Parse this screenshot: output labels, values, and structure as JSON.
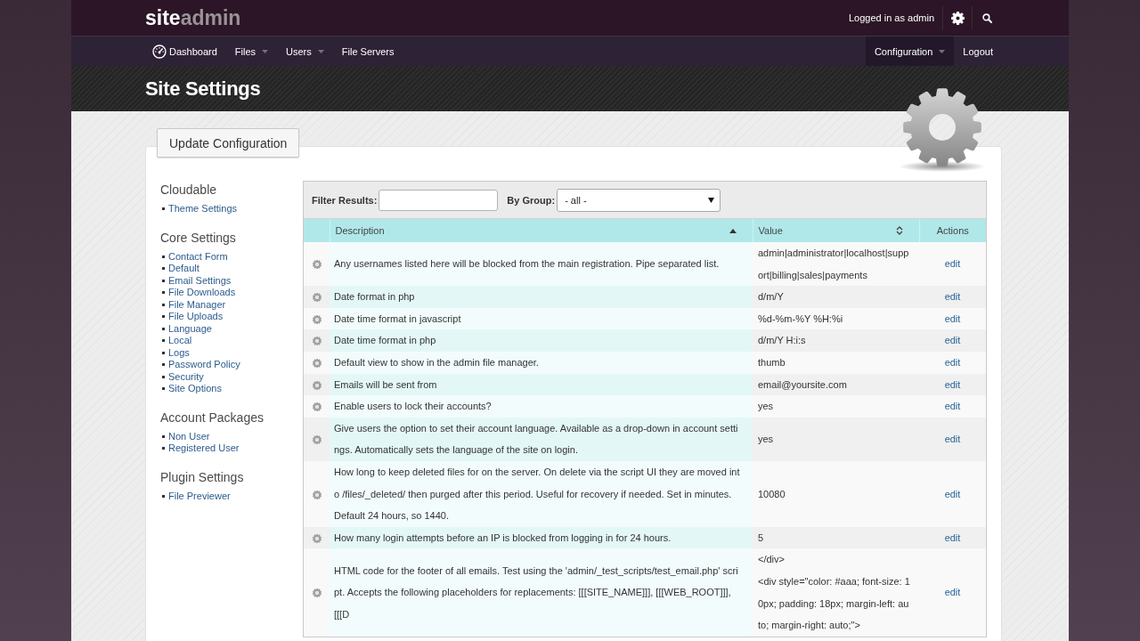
{
  "header": {
    "logo": [
      "site",
      "admin"
    ],
    "user_label": "Logged in as admin"
  },
  "nav": {
    "left": [
      {
        "label": "Dashboard",
        "kind": "home",
        "selected": false
      },
      {
        "label": "Files",
        "kind": "dropdown",
        "selected": false
      },
      {
        "label": "Users",
        "kind": "dropdown",
        "selected": false
      },
      {
        "label": "File Servers",
        "kind": "link",
        "selected": false
      }
    ],
    "right": [
      {
        "label": "Configuration",
        "kind": "dropdown",
        "selected": true
      },
      {
        "label": "Logout",
        "kind": "link",
        "selected": false
      }
    ]
  },
  "page_title": "Site Settings",
  "update_button": "Update Configuration",
  "sidebar": {
    "groups": [
      {
        "title": "Cloudable",
        "items": [
          "Theme Settings"
        ]
      },
      {
        "title": "Core Settings",
        "items": [
          "Contact Form",
          "Default",
          "Email Settings",
          "File Downloads",
          "File Manager",
          "File Uploads",
          "Language",
          "Local",
          "Logs",
          "Password Policy",
          "Security",
          "Site Options"
        ]
      },
      {
        "title": "Account Packages",
        "items": [
          "Non User",
          "Registered User"
        ]
      },
      {
        "title": "Plugin Settings",
        "items": [
          "File Previewer"
        ]
      }
    ]
  },
  "filter": {
    "label": "Filter Results:",
    "group_label": "By Group:",
    "group_value": "- all -"
  },
  "table": {
    "columns": [
      {
        "label": "Description",
        "kind": "sorted"
      },
      {
        "label": "Value",
        "kind": "sortable"
      },
      {
        "label": "Actions",
        "kind": "plain"
      }
    ],
    "rows": [
      {
        "description": "Any usernames listed here will be blocked from the main registration. Pipe separated list.",
        "value": "admin|administrator|localhost|support|billing|sales|payments",
        "action": "edit"
      },
      {
        "description": "Date format in php",
        "value": "d/m/Y",
        "action": "edit"
      },
      {
        "description": "Date time format in javascript",
        "value": "%d-%m-%Y %H:%i",
        "action": "edit"
      },
      {
        "description": "Date time format in php",
        "value": "d/m/Y H:i:s",
        "action": "edit"
      },
      {
        "description": "Default view to show in the admin file manager.",
        "value": "thumb",
        "action": "edit"
      },
      {
        "description": "Emails will be sent from",
        "value": "email@yoursite.com",
        "action": "edit"
      },
      {
        "description": "Enable users to lock their accounts?",
        "value": "yes",
        "action": "edit"
      },
      {
        "description": "Give users the option to set their account language. Available as a drop-down in account settings. Automatically sets the language of the site on login.",
        "value": "yes",
        "action": "edit"
      },
      {
        "description": "How long to keep deleted files for on the server. On delete via the script UI they are moved into /files/_deleted/ then purged after this period. Useful for recovery if needed. Set in minutes. Default 24 hours, so 1440.",
        "value": "10080",
        "action": "edit"
      },
      {
        "description": "How many login attempts before an IP is blocked from logging in for 24 hours.",
        "value": "5",
        "action": "edit"
      },
      {
        "description": "HTML code for the footer of all emails. Test using the 'admin/_test_scripts/test_email.php' script. Accepts the following placeholders for replacements: [[[SITE_NAME]]], [[[WEB_ROOT]]], [[[D",
        "value": "</div>\n<div style=\"color: #aaa; font-size: 10px; padding: 18px; margin-left: auto; margin-right: auto;\">",
        "action": "edit"
      }
    ]
  }
}
